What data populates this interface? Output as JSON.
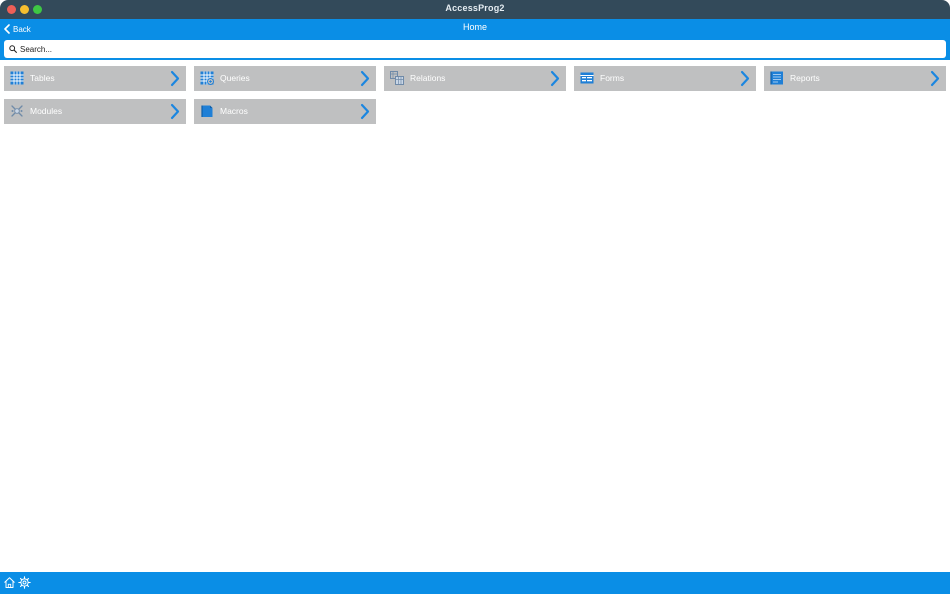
{
  "window": {
    "title": "AccessProg2"
  },
  "nav": {
    "back_label": "Back",
    "title": "Home"
  },
  "search": {
    "placeholder": "Search..."
  },
  "tiles": [
    {
      "label": "Tables",
      "icon": "table-icon"
    },
    {
      "label": "Queries",
      "icon": "query-icon"
    },
    {
      "label": "Relations",
      "icon": "relations-icon"
    },
    {
      "label": "Forms",
      "icon": "form-icon"
    },
    {
      "label": "Reports",
      "icon": "report-icon"
    },
    {
      "label": "Modules",
      "icon": "module-icon"
    },
    {
      "label": "Macros",
      "icon": "macro-icon"
    }
  ],
  "bottom": {
    "icons": [
      "home-icon",
      "settings-icon"
    ]
  },
  "colors": {
    "accent": "#0a8ee6",
    "titlebar": "#334a5a",
    "tile": "#bfc0c1"
  }
}
